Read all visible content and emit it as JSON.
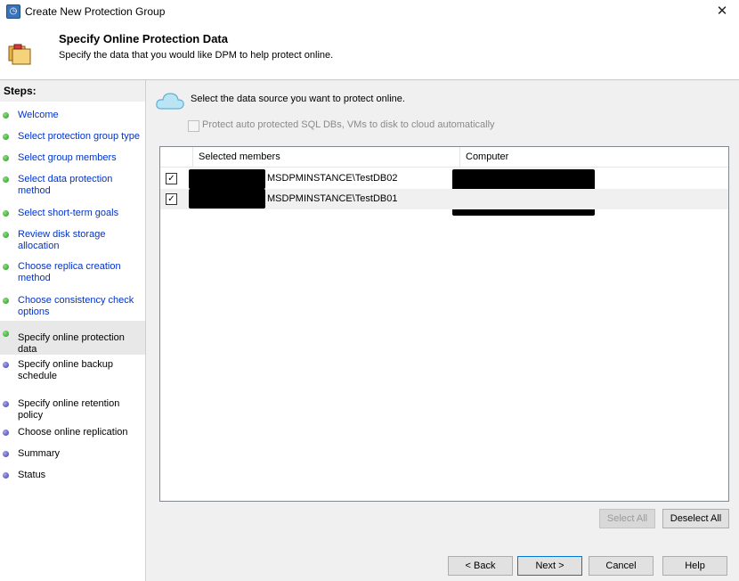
{
  "window": {
    "title": "Create New Protection Group",
    "close_glyph": "✕"
  },
  "header": {
    "title": "Specify Online Protection Data",
    "subtitle": "Specify the data that you would like DPM to help protect online."
  },
  "steps": {
    "heading": "Steps:",
    "items": [
      {
        "label": "Welcome",
        "status": "done"
      },
      {
        "label": "Select protection group type",
        "status": "done"
      },
      {
        "label": "Select group members",
        "status": "done"
      },
      {
        "label": "Select data protection method",
        "status": "done"
      },
      {
        "label": "Select short-term goals",
        "status": "done"
      },
      {
        "label": "Review disk storage allocation",
        "status": "done"
      },
      {
        "label": "Choose replica creation method",
        "status": "done"
      },
      {
        "label": "Choose consistency check options",
        "status": "done"
      },
      {
        "label": "Specify online protection data",
        "status": "current"
      },
      {
        "label": "Specify online backup schedule",
        "status": "todo"
      },
      {
        "label": "Specify online retention policy",
        "status": "todo"
      },
      {
        "label": "Choose online replication",
        "status": "todo"
      },
      {
        "label": "Summary",
        "status": "todo"
      },
      {
        "label": "Status",
        "status": "todo"
      }
    ]
  },
  "main": {
    "instruction": "Select the data source you want to protect online.",
    "auto_protect_label": "Protect auto protected SQL DBs, VMs to disk to cloud automatically",
    "auto_protect_checked": false,
    "columns": [
      "Selected members",
      "Computer"
    ],
    "rows": [
      {
        "checked": true,
        "member": "MSDPMINSTANCE\\TestDB02"
      },
      {
        "checked": true,
        "member": "MSDPMINSTANCE\\TestDB01"
      }
    ],
    "check_glyph": "✓"
  },
  "buttons": {
    "select_all": "Select All",
    "deselect_all": "Deselect All",
    "back": "< Back",
    "next": "Next >",
    "cancel": "Cancel",
    "help": "Help"
  }
}
